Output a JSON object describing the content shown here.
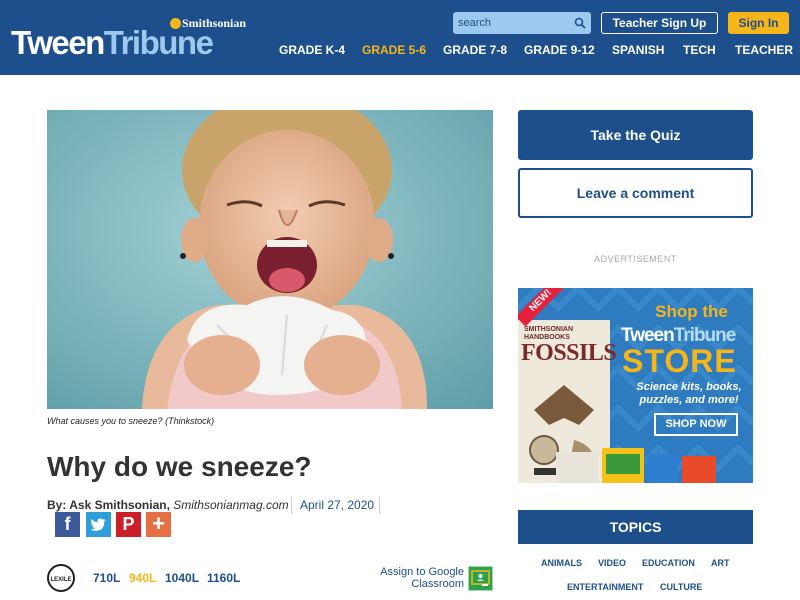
{
  "colors": {
    "brand": "#1d4f8c",
    "accent": "#f6b619",
    "light": "#9ec9ee"
  },
  "header": {
    "logo_tween": "Tween",
    "logo_tribune": "Tribune",
    "logo_smithsonian": "Smithsonian",
    "search_placeholder": "search",
    "teacher_signup": "Teacher Sign Up",
    "sign_in": "Sign In",
    "nav": [
      "GRADE K-4",
      "GRADE 5-6",
      "GRADE 7-8",
      "GRADE 9-12",
      "SPANISH",
      "TECH",
      "TEACHER"
    ],
    "nav_active": "GRADE 5-6"
  },
  "article": {
    "caption": "What causes you to sneeze? (Thinkstock)",
    "title": "Why do we sneeze?",
    "by_label": "By: Ask Smithsonian,",
    "source": "Smithsonianmag.com",
    "date": "April 27, 2020",
    "share_icons": [
      "facebook-icon",
      "twitter-icon",
      "pinterest-icon",
      "plus-icon"
    ],
    "share_glyphs": [
      "f",
      "t",
      "P",
      "+"
    ],
    "lexile_levels": [
      "710L",
      "940L",
      "1040L",
      "1160L"
    ],
    "lexile_active": "940L",
    "google_classroom": "Assign to Google Classroom"
  },
  "sidebar": {
    "quiz": "Take the Quiz",
    "comment": "Leave a comment",
    "ad_label": "ADVERTISEMENT",
    "ad": {
      "new": "NEW!",
      "book_series": "SMITHSONIAN HANDBOOKS",
      "book_title": "FOSSILS",
      "shop_the": "Shop the",
      "tween": "Tween",
      "tribune": "Tribune",
      "store": "STORE",
      "tagline": "Science kits, books, puzzles, and more!",
      "shop_now": "SHOP NOW"
    },
    "topics_title": "TOPICS",
    "topics": [
      "ANIMALS",
      "VIDEO",
      "EDUCATION",
      "ART",
      "ENTERTAINMENT",
      "CULTURE"
    ]
  }
}
